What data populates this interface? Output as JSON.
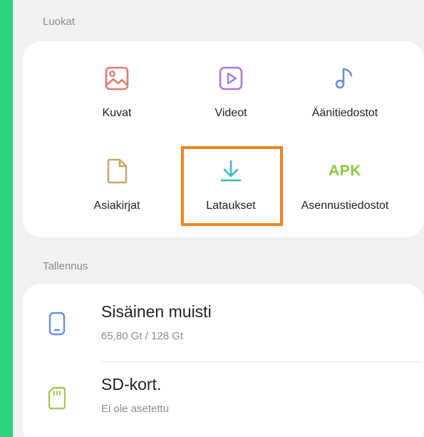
{
  "categories_section": {
    "label": "Luokat",
    "items": [
      {
        "label": "Kuvat",
        "icon": "image-icon",
        "color": "#e07a6f"
      },
      {
        "label": "Videot",
        "icon": "video-icon",
        "color": "#a97ad9"
      },
      {
        "label": "Äänitiedostot",
        "icon": "music-note-icon",
        "color": "#6a8fe0"
      },
      {
        "label": "Asiakirjat",
        "icon": "document-icon",
        "color": "#c9a86a"
      },
      {
        "label": "Lataukset",
        "icon": "download-icon",
        "color": "#3fb6c4"
      },
      {
        "label": "Asennustiedostot",
        "icon": "apk-icon",
        "icon_text": "APK",
        "color": "#8dc63f"
      }
    ],
    "highlighted_item": "Lataukset",
    "highlight_color": "#f58220"
  },
  "storage_section": {
    "label": "Tallennus",
    "items": [
      {
        "title": "Sisäinen muisti",
        "subtitle": "65,80 Gt / 128 Gt",
        "icon": "phone-storage-icon",
        "color": "#6a8fe0"
      },
      {
        "title": "SD-kort.",
        "subtitle": "Ei ole asetettu",
        "icon": "sd-card-icon",
        "color": "#a4c95a"
      }
    ]
  }
}
